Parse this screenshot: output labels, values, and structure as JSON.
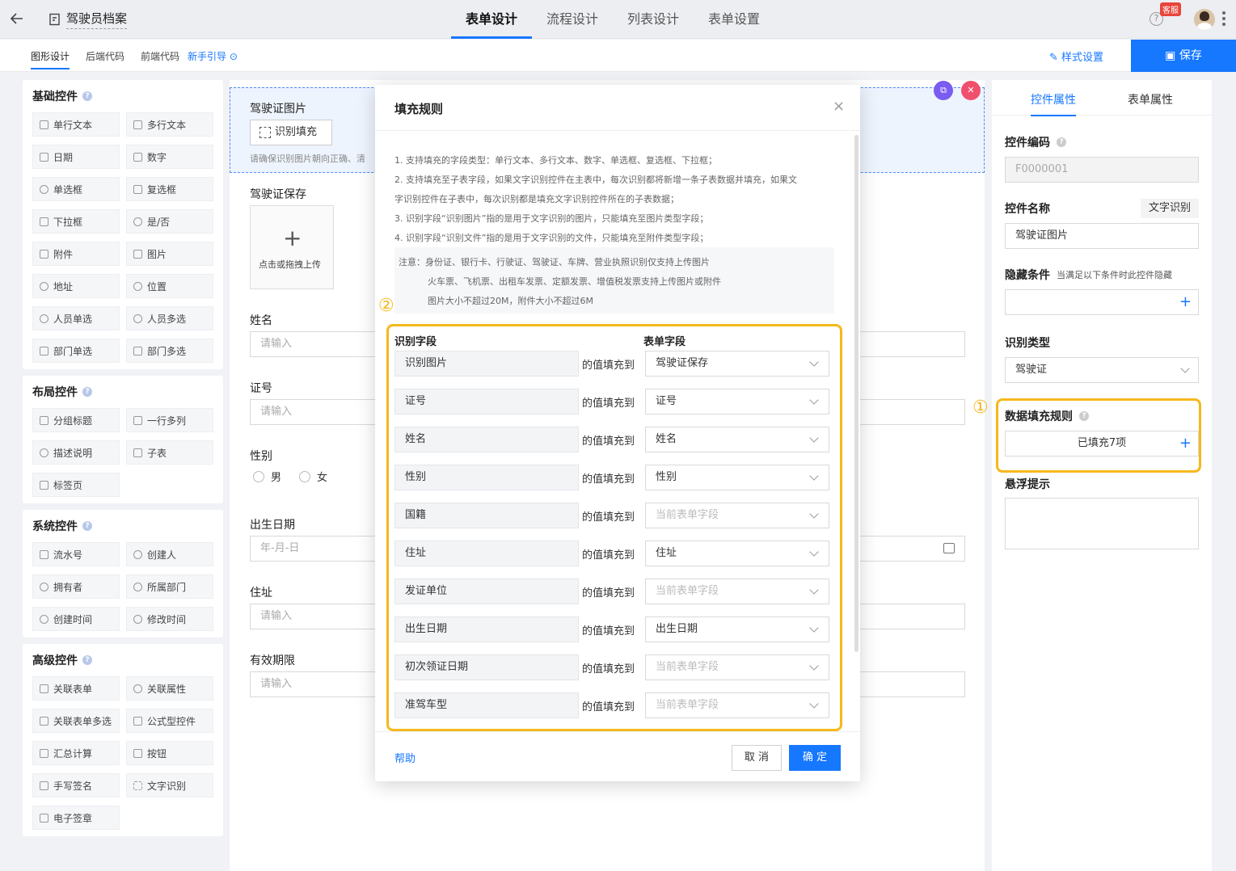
{
  "header": {
    "app_title": "驾驶员档案",
    "tabs": [
      "表单设计",
      "流程设计",
      "列表设计",
      "表单设置"
    ],
    "service_badge": "客服",
    "help_mark": "?"
  },
  "subbar": {
    "tabs": [
      "图形设计",
      "后端代码",
      "前端代码"
    ],
    "guide": "新手引导",
    "style_settings": "样式设置",
    "save": "保存"
  },
  "palette": {
    "sections": [
      {
        "title": "基础控件",
        "items": [
          "单行文本",
          "多行文本",
          "日期",
          "数字",
          "单选框",
          "复选框",
          "下拉框",
          "是/否",
          "附件",
          "图片",
          "地址",
          "位置",
          "人员单选",
          "人员多选",
          "部门单选",
          "部门多选"
        ]
      },
      {
        "title": "布局控件",
        "items": [
          "分组标题",
          "一行多列",
          "描述说明",
          "子表",
          "标签页"
        ]
      },
      {
        "title": "系统控件",
        "items": [
          "流水号",
          "创建人",
          "拥有者",
          "所属部门",
          "创建时间",
          "修改时间"
        ]
      },
      {
        "title": "高级控件",
        "items": [
          "关联表单",
          "关联属性",
          "关联表单多选",
          "公式型控件",
          "汇总计算",
          "按钮",
          "手写签名",
          "文字识别",
          "电子签章"
        ]
      }
    ]
  },
  "canvas": {
    "ocr_field_label": "驾驶证图片",
    "ocr_button": "识别填充",
    "ocr_hint": "请确保识别图片朝向正确、清",
    "upload_label": "驾驶证保存",
    "upload_text": "点击或拖拽上传",
    "name_label": "姓名",
    "name_placeholder": "请输入",
    "idno_label": "证号",
    "idno_placeholder": "请输入",
    "gender_label": "性别",
    "gender_options": [
      "男",
      "女"
    ],
    "birth_label": "出生日期",
    "birth_placeholder": "年-月-日",
    "address_label": "住址",
    "address_placeholder": "请输入",
    "validity_label": "有效期限",
    "validity_placeholder": "请输入"
  },
  "right_panel": {
    "tabs": [
      "控件属性",
      "表单属性"
    ],
    "code_label": "控件编码",
    "code_value": "F0000001",
    "name_label": "控件名称",
    "name_tag": "文字识别",
    "name_value": "驾驶证图片",
    "hide_label": "隐藏条件",
    "hide_hint": "当满足以下条件时此控件隐藏",
    "ocr_type_label": "识别类型",
    "ocr_type_value": "驾驶证",
    "fill_rule_label": "数据填充规则",
    "fill_rule_value": "已填充7项",
    "tooltip_label": "悬浮提示",
    "marker": "①"
  },
  "modal": {
    "title": "填充规则",
    "close": "×",
    "rules": [
      "1. 支持填充的字段类型：单行文本、多行文本、数字、单选框、复选框、下拉框；",
      "2. 支持填充至子表字段，如果文字识别控件在主表中，每次识别都将新增一条子表数据并填充，如果文",
      "字识别控件在子表中，每次识别都是填充文字识别控件所在的子表数据；",
      "3. 识别字段“识别图片”指的是用于文字识别的图片，只能填充至图片类型字段；",
      "4. 识别字段“识别文件”指的是用于文字识别的文件，只能填充至附件类型字段；"
    ],
    "notes": [
      "注意：身份证、银行卡、行驶证、驾驶证、车牌、营业执照识别仅支持上传图片",
      "火车票、飞机票、出租车发票、定额发票、增值税发票支持上传图片或附件",
      "图片大小不超过20M，附件大小不超过6M"
    ],
    "marker": "②",
    "col_source": "识别字段",
    "col_target": "表单字段",
    "fill_to": "的值填充到",
    "rows": [
      {
        "source": "识别图片",
        "target": "驾驶证保存",
        "empty": false
      },
      {
        "source": "证号",
        "target": "证号",
        "empty": false
      },
      {
        "source": "姓名",
        "target": "姓名",
        "empty": false
      },
      {
        "source": "性别",
        "target": "性别",
        "empty": false
      },
      {
        "source": "国籍",
        "target": "当前表单字段",
        "empty": true
      },
      {
        "source": "住址",
        "target": "住址",
        "empty": false
      },
      {
        "source": "发证单位",
        "target": "当前表单字段",
        "empty": true
      },
      {
        "source": "出生日期",
        "target": "出生日期",
        "empty": false
      },
      {
        "source": "初次领证日期",
        "target": "当前表单字段",
        "empty": true
      },
      {
        "source": "准驾车型",
        "target": "当前表单字段",
        "empty": true
      }
    ],
    "help": "帮助",
    "cancel": "取 消",
    "ok": "确 定"
  },
  "colors": {
    "accent": "#1677ff",
    "highlight": "#f6b81c"
  }
}
